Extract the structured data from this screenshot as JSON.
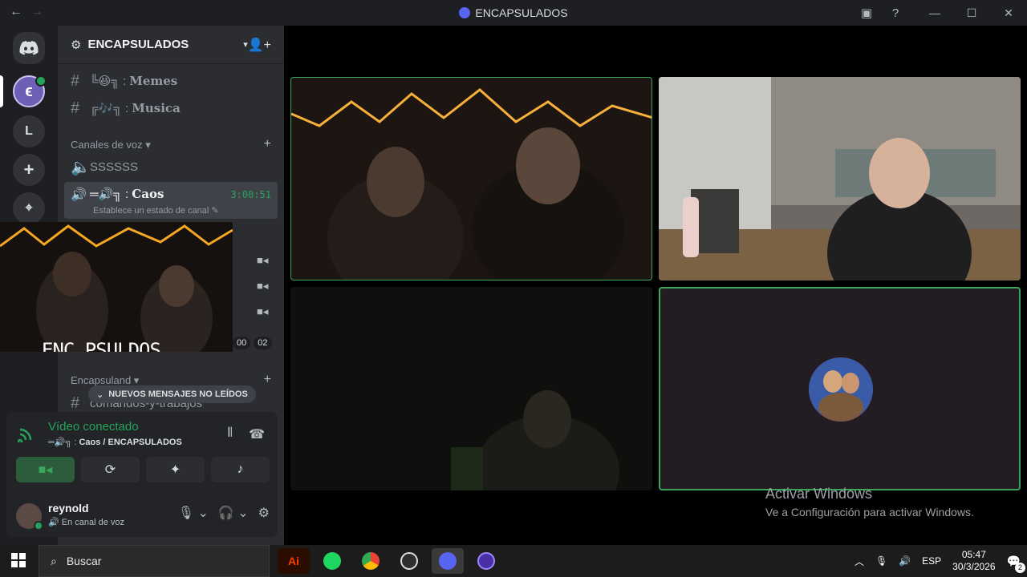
{
  "window": {
    "title": "ENCAPSULADOS",
    "back_icon": "←",
    "forward_icon": "→",
    "inbox_icon": "▣",
    "help_icon": "?",
    "minimize": "—",
    "maximize": "☐",
    "close": "✕"
  },
  "servers": {
    "home_icon": "discord-logo",
    "items": [
      {
        "label": "",
        "kind": "active-server"
      },
      {
        "label": "L",
        "kind": "server"
      },
      {
        "label": "+",
        "kind": "add-server"
      },
      {
        "label": "⌖",
        "kind": "explore"
      }
    ]
  },
  "sidebar": {
    "guild_name": "ENCAPSULADOS",
    "text_channels": [
      {
        "prefix": "╚😆╗ :",
        "name": "Memes"
      },
      {
        "prefix": "╔🎶╗ :",
        "name": "Musica"
      }
    ],
    "voice_category": "Canales de voz",
    "voice_channels": [
      {
        "name": "SSSSSS"
      },
      {
        "prefix": "═🔊╗ :",
        "name": "Caos",
        "timer": "3:00:51",
        "status": "Establece un estado de canal"
      }
    ],
    "popout_logo": "ENC PSULDOS",
    "badges": [
      "00",
      "02"
    ],
    "category_2": "Encapsuland",
    "partial_channel": "comandos-y-trabajos",
    "unread_banner": "NUEVOS MENSAJES NO LEÍDOS"
  },
  "voice_panel": {
    "status": "Vídeo conectado",
    "channel_prefix": "═🔊╗ : ",
    "channel": "Caos / ENCAPSULADOS",
    "buttons": [
      "camera",
      "screen-share",
      "activities",
      "soundboard"
    ]
  },
  "user": {
    "name": "reynold",
    "status": "En canal de voz"
  },
  "watermark": {
    "title": "Activar Windows",
    "subtitle": "Ve a Configuración para activar Windows."
  },
  "taskbar": {
    "search_placeholder": "Buscar",
    "apps": [
      "Adobe Illustrator",
      "Spotify",
      "Chrome",
      "OBS",
      "Discord",
      "Other"
    ],
    "language": "ESP",
    "time": "05:47",
    "date": "30/3/2026",
    "notifications": "2"
  },
  "colors": {
    "accent_green": "#23a559",
    "sidebar_bg": "#2b2d31",
    "server_bg": "#1e1f22"
  }
}
